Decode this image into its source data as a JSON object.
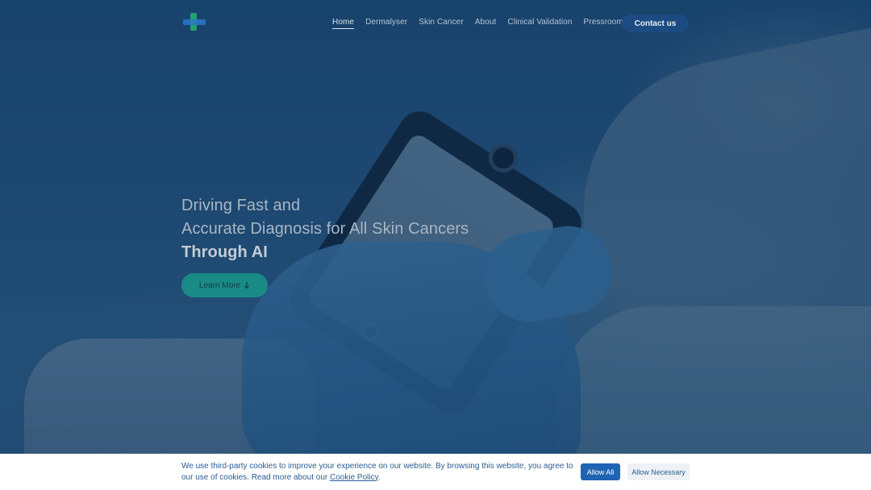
{
  "nav": {
    "links": [
      {
        "label": "Home",
        "active": true
      },
      {
        "label": "Dermalyser"
      },
      {
        "label": "Skin Cancer"
      },
      {
        "label": "About"
      },
      {
        "label": "Clinical Validation"
      },
      {
        "label": "Pressroom"
      }
    ],
    "contact_label": "Contact us"
  },
  "hero": {
    "line1": "Driving Fast and",
    "line2": "Accurate Diagnosis for All Skin Cancers",
    "line3": "Through AI",
    "button_label": "Learn More",
    "button_icon": "arrow-down-icon"
  },
  "cookie": {
    "text_before": "We use third-party cookies to improve your experience on our website. By browsing this website, you agree to our use of cookies. Read more about our ",
    "link_text": "Cookie Policy",
    "text_after": ".",
    "allow_all_label": "Allow All",
    "allow_necessary_label": "Allow Necessary"
  },
  "colors": {
    "logo_green": "#1fa36f",
    "logo_blue": "#2a78c8",
    "contact_bg": "#1b4b80",
    "learn_bg": "#1a8a86",
    "cookie_text": "#2b5d93",
    "allow_all_bg": "#1f63b3"
  }
}
